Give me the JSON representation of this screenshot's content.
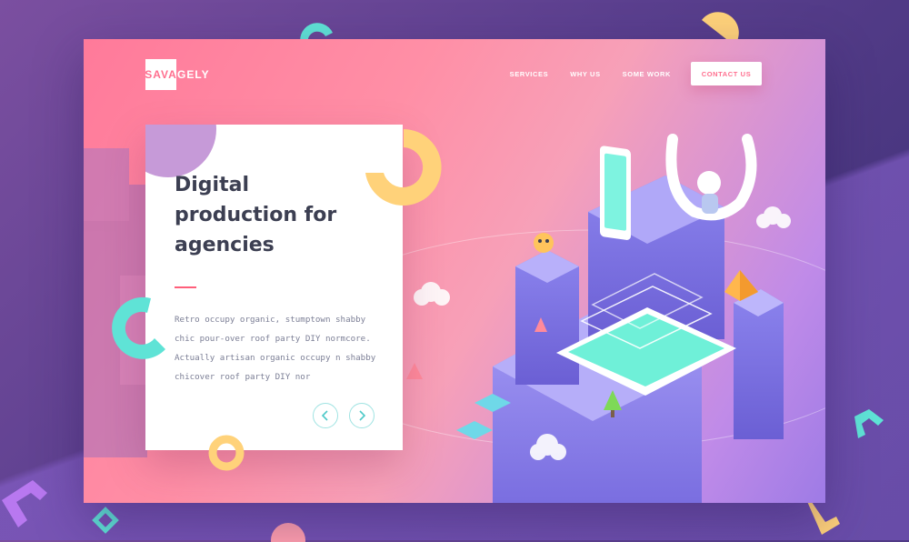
{
  "brand": {
    "logo_box": "SAVA",
    "logo_rest": "GELY"
  },
  "nav": {
    "items": [
      "SERVICES",
      "WHY US",
      "SOME WORK"
    ],
    "cta": "CONTACT US"
  },
  "hero": {
    "title": "Digital production for agencies",
    "body": "Retro occupy organic, stumptown shabby chic pour-over roof party DIY normcore. Actually artisan organic occupy n shabby chicover roof party DIY nor",
    "prev_icon": "chevron-left-icon",
    "next_icon": "chevron-right-icon"
  },
  "colors": {
    "accent": "#ff6f8f",
    "teal": "#5fe3d6",
    "yellow": "#ffd27a",
    "purple": "#8e7be6"
  }
}
